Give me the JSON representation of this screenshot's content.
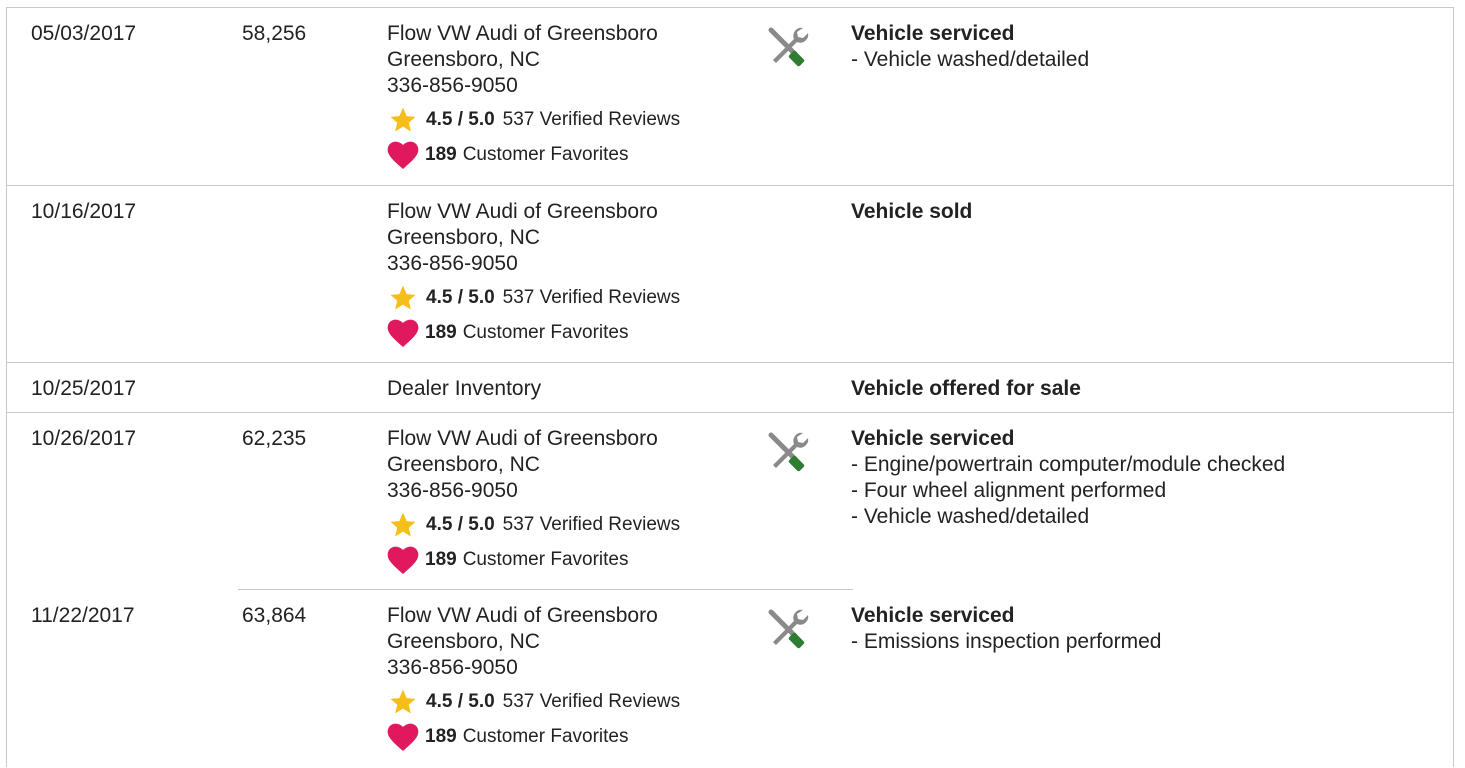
{
  "history": [
    {
      "date": "05/03/2017",
      "mileage": "58,256",
      "source": {
        "name": "Flow VW Audi of Greensboro",
        "location": "Greensboro, NC",
        "phone": "336-856-9050",
        "rating": "4.5 / 5.0",
        "reviews": "537 Verified Reviews",
        "favorites_count": "189",
        "favorites_label": "Customer Favorites"
      },
      "icon": "service-tools-icon",
      "title": "Vehicle serviced",
      "details": [
        "Vehicle washed/detailed"
      ]
    },
    {
      "date": "10/16/2017",
      "mileage": "",
      "source": {
        "name": "Flow VW Audi of Greensboro",
        "location": "Greensboro, NC",
        "phone": "336-856-9050",
        "rating": "4.5 / 5.0",
        "reviews": "537 Verified Reviews",
        "favorites_count": "189",
        "favorites_label": "Customer Favorites"
      },
      "icon": "",
      "title": "Vehicle sold",
      "details": []
    },
    {
      "date": "10/25/2017",
      "mileage": "",
      "source": {
        "name": "Dealer Inventory"
      },
      "icon": "",
      "title": "Vehicle offered for sale",
      "details": []
    },
    {
      "date": "10/26/2017",
      "mileage": "62,235",
      "source": {
        "name": "Flow VW Audi of Greensboro",
        "location": "Greensboro, NC",
        "phone": "336-856-9050",
        "rating": "4.5 / 5.0",
        "reviews": "537 Verified Reviews",
        "favorites_count": "189",
        "favorites_label": "Customer Favorites"
      },
      "icon": "service-tools-icon",
      "title": "Vehicle serviced",
      "details": [
        "Engine/powertrain computer/module checked",
        "Four wheel alignment performed",
        "Vehicle washed/detailed"
      ]
    },
    {
      "date": "11/22/2017",
      "mileage": "63,864",
      "source": {
        "name": "Flow VW Audi of Greensboro",
        "location": "Greensboro, NC",
        "phone": "336-856-9050",
        "rating": "4.5 / 5.0",
        "reviews": "537 Verified Reviews",
        "favorites_count": "189",
        "favorites_label": "Customer Favorites"
      },
      "icon": "service-tools-icon",
      "title": "Vehicle serviced",
      "details": [
        "Emissions inspection performed"
      ]
    }
  ],
  "colors": {
    "star": "#f5be1b",
    "heart": "#e0195f",
    "tool_gray": "#8a8a8a",
    "tool_green": "#2e7d32",
    "border": "#c9c9c9"
  }
}
